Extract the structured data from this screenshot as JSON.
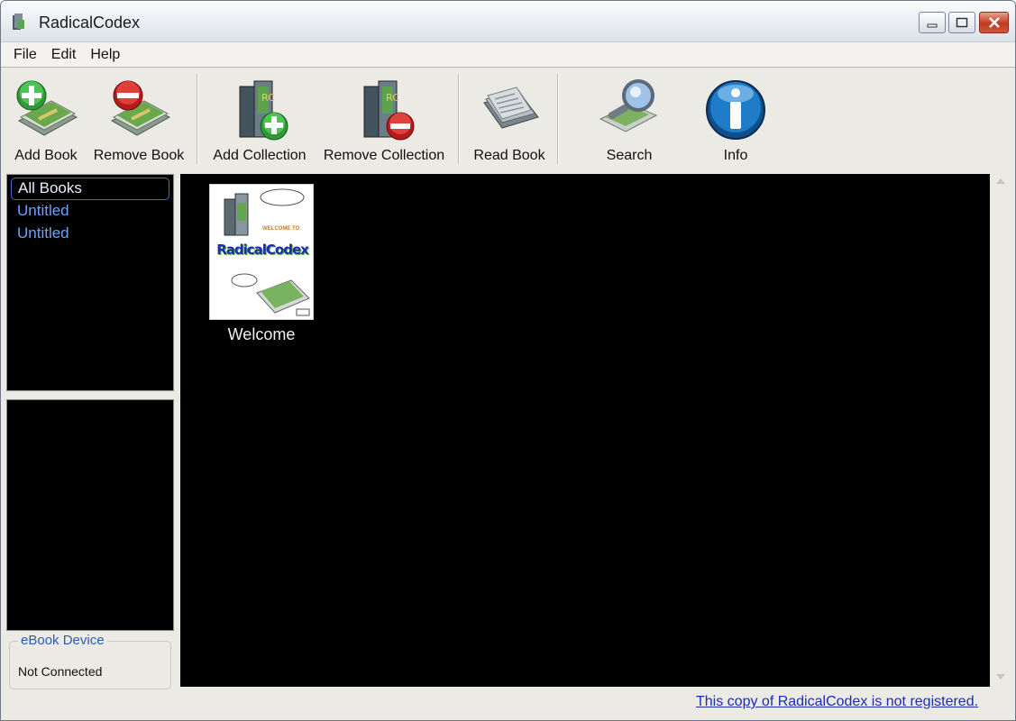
{
  "window": {
    "title": "RadicalCodex",
    "icon": "app-book-icon"
  },
  "menu": {
    "file": "File",
    "edit": "Edit",
    "help": "Help"
  },
  "toolbar": {
    "add_book": {
      "label": "Add Book",
      "icon": "add-book-icon"
    },
    "remove_book": {
      "label": "Remove Book",
      "icon": "remove-book-icon"
    },
    "add_collection": {
      "label": "Add Collection",
      "icon": "add-collection-icon"
    },
    "remove_collection": {
      "label": "Remove Collection",
      "icon": "remove-collection-icon"
    },
    "read_book": {
      "label": "Read Book",
      "icon": "read-book-icon"
    },
    "search": {
      "label": "Search",
      "icon": "search-icon"
    },
    "info": {
      "label": "Info",
      "icon": "info-icon"
    }
  },
  "collections": {
    "items": [
      {
        "label": "All Books",
        "selected": true
      },
      {
        "label": "Untitled",
        "selected": false
      },
      {
        "label": "Untitled",
        "selected": false
      }
    ]
  },
  "device": {
    "group_title": "eBook Device",
    "status": "Not Connected"
  },
  "library": {
    "books": [
      {
        "title": "Welcome",
        "cover_text": "RadicalCodex",
        "cover_subtext": "WELCOME TO"
      }
    ]
  },
  "status_bar": {
    "registration_link": "This copy of RadicalCodex is not registered."
  },
  "colors": {
    "list_text": "#6ba2ff",
    "panel_background": "#000000",
    "window_chrome": "#eceae4",
    "link": "#1a2fb0"
  }
}
